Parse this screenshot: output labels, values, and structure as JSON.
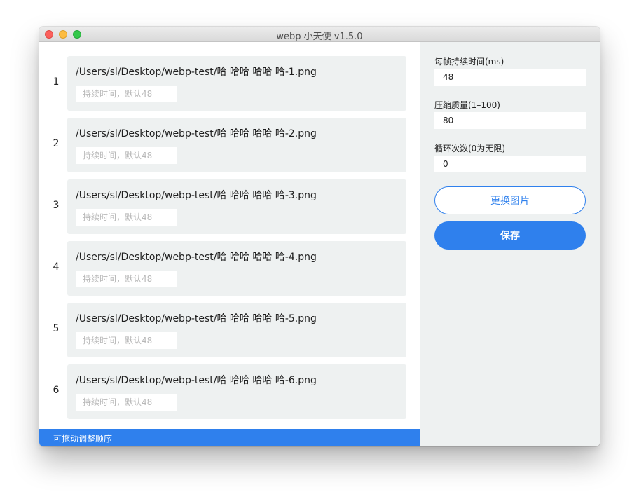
{
  "window": {
    "title": "webp 小天使 v1.5.0"
  },
  "frames": [
    {
      "index": "1",
      "path": "/Users/sl/Desktop/webp-test/哈 哈哈 哈哈 哈-1.png",
      "duration_placeholder": "持续时间，默认48",
      "duration_value": ""
    },
    {
      "index": "2",
      "path": "/Users/sl/Desktop/webp-test/哈 哈哈 哈哈 哈-2.png",
      "duration_placeholder": "持续时间，默认48",
      "duration_value": ""
    },
    {
      "index": "3",
      "path": "/Users/sl/Desktop/webp-test/哈 哈哈 哈哈 哈-3.png",
      "duration_placeholder": "持续时间，默认48",
      "duration_value": ""
    },
    {
      "index": "4",
      "path": "/Users/sl/Desktop/webp-test/哈 哈哈 哈哈 哈-4.png",
      "duration_placeholder": "持续时间，默认48",
      "duration_value": ""
    },
    {
      "index": "5",
      "path": "/Users/sl/Desktop/webp-test/哈 哈哈 哈哈 哈-5.png",
      "duration_placeholder": "持续时间，默认48",
      "duration_value": ""
    },
    {
      "index": "6",
      "path": "/Users/sl/Desktop/webp-test/哈 哈哈 哈哈 哈-6.png",
      "duration_placeholder": "持续时间，默认48",
      "duration_value": ""
    }
  ],
  "footer": {
    "hint": "可拖动调整顺序"
  },
  "settings": {
    "frame_duration": {
      "label": "每帧持续时间(ms)",
      "value": "48"
    },
    "quality": {
      "label": "压缩质量(1–100)",
      "value": "80"
    },
    "loop": {
      "label": "循环次数(0为无限)",
      "value": "0"
    },
    "change_images_label": "更换图片",
    "save_label": "保存"
  },
  "colors": {
    "accent": "#2f80ed",
    "panel_background": "#eef1f1",
    "traffic_close": "#fc605c",
    "traffic_minimize": "#fdbc40",
    "traffic_zoom": "#34c84a"
  }
}
